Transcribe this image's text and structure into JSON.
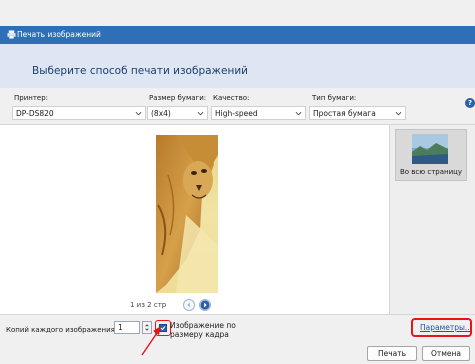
{
  "window": {
    "title": "Печать изображений",
    "header": "Выберите способ печати изображений"
  },
  "options": {
    "printer": {
      "label": "Принтер:",
      "value": "DP-DS820"
    },
    "paper_size": {
      "label": "Размер бумаги:",
      "value": "(8x4)"
    },
    "quality": {
      "label": "Качество:",
      "value": "High-speed"
    },
    "paper_type": {
      "label": "Тип бумаги:",
      "value": "Простая бумага"
    },
    "help": "?"
  },
  "preview": {
    "page_indicator": "1 из 2 стр"
  },
  "layouts": [
    {
      "label": "Во всю страницу",
      "selected": true
    }
  ],
  "bottom": {
    "copies_label": "Копий каждого изображения:",
    "copies_value": "1",
    "fit_label": "Изображение по размеру кадра",
    "fit_checked": true,
    "params_link": "Параметры...",
    "print_button": "Печать",
    "cancel_button": "Отмена"
  },
  "colors": {
    "titlebar": "#2f6fb7",
    "header_bg": "#dde6f2",
    "highlight": "#e8141c",
    "link": "#1a56b0"
  }
}
